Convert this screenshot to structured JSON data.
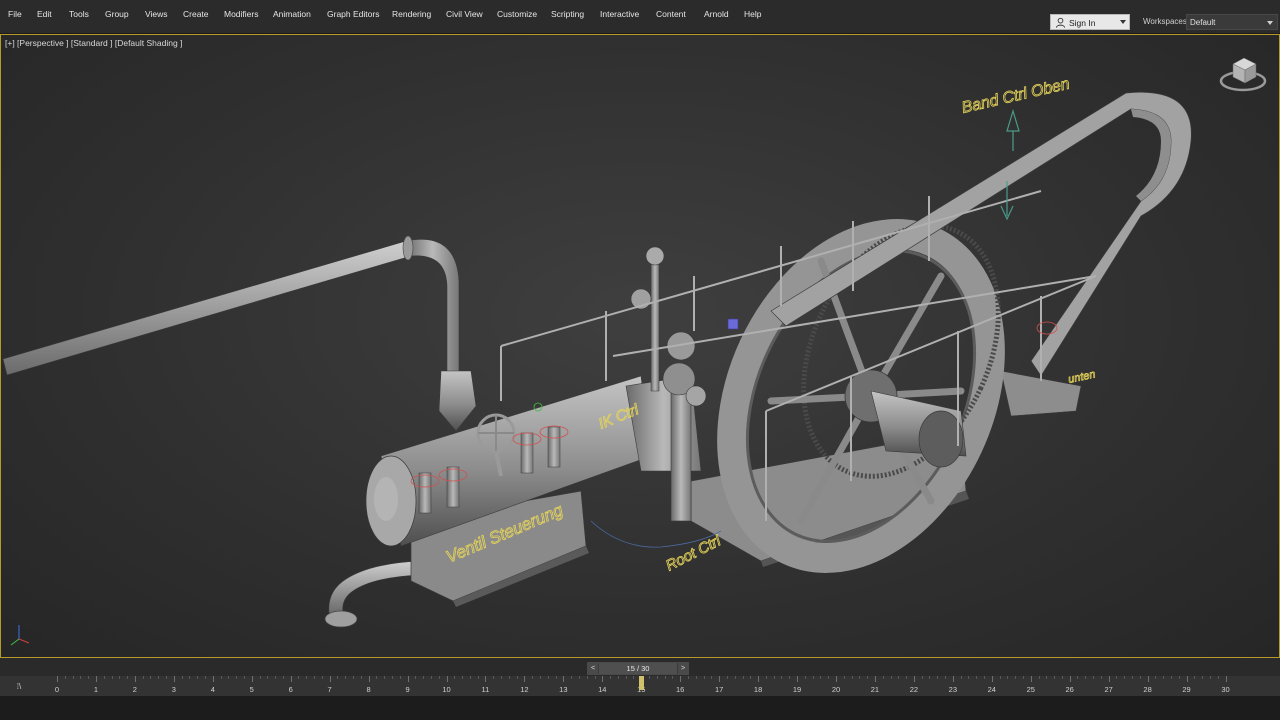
{
  "menubar": {
    "items": [
      "File",
      "Edit",
      "Tools",
      "Group",
      "Views",
      "Create",
      "Modifiers",
      "Animation",
      "Graph Editors",
      "Rendering",
      "Civil View",
      "Customize",
      "Scripting",
      "Interactive",
      "Content",
      "Arnold",
      "Help"
    ],
    "sign_in": "Sign In",
    "workspaces_label": "Workspaces:",
    "workspace_value": "Default"
  },
  "viewport": {
    "label": "[+] [Perspective ] [Standard ] [Default Shading ]",
    "annotations": {
      "band_ctrl": "Band Ctrl Oben",
      "ventil": "Ventil Steuerung",
      "root": "Root Ctrl",
      "ik": "IK Ctrl",
      "unten": "unten"
    }
  },
  "timeline": {
    "frame_display": "15 / 30",
    "current_frame": 15,
    "frame_start": 0,
    "frame_end": 30,
    "toggle_label": "⁞\\"
  },
  "colors": {
    "accent_border": "#b89a2a",
    "annotation": "#e4d35a"
  }
}
